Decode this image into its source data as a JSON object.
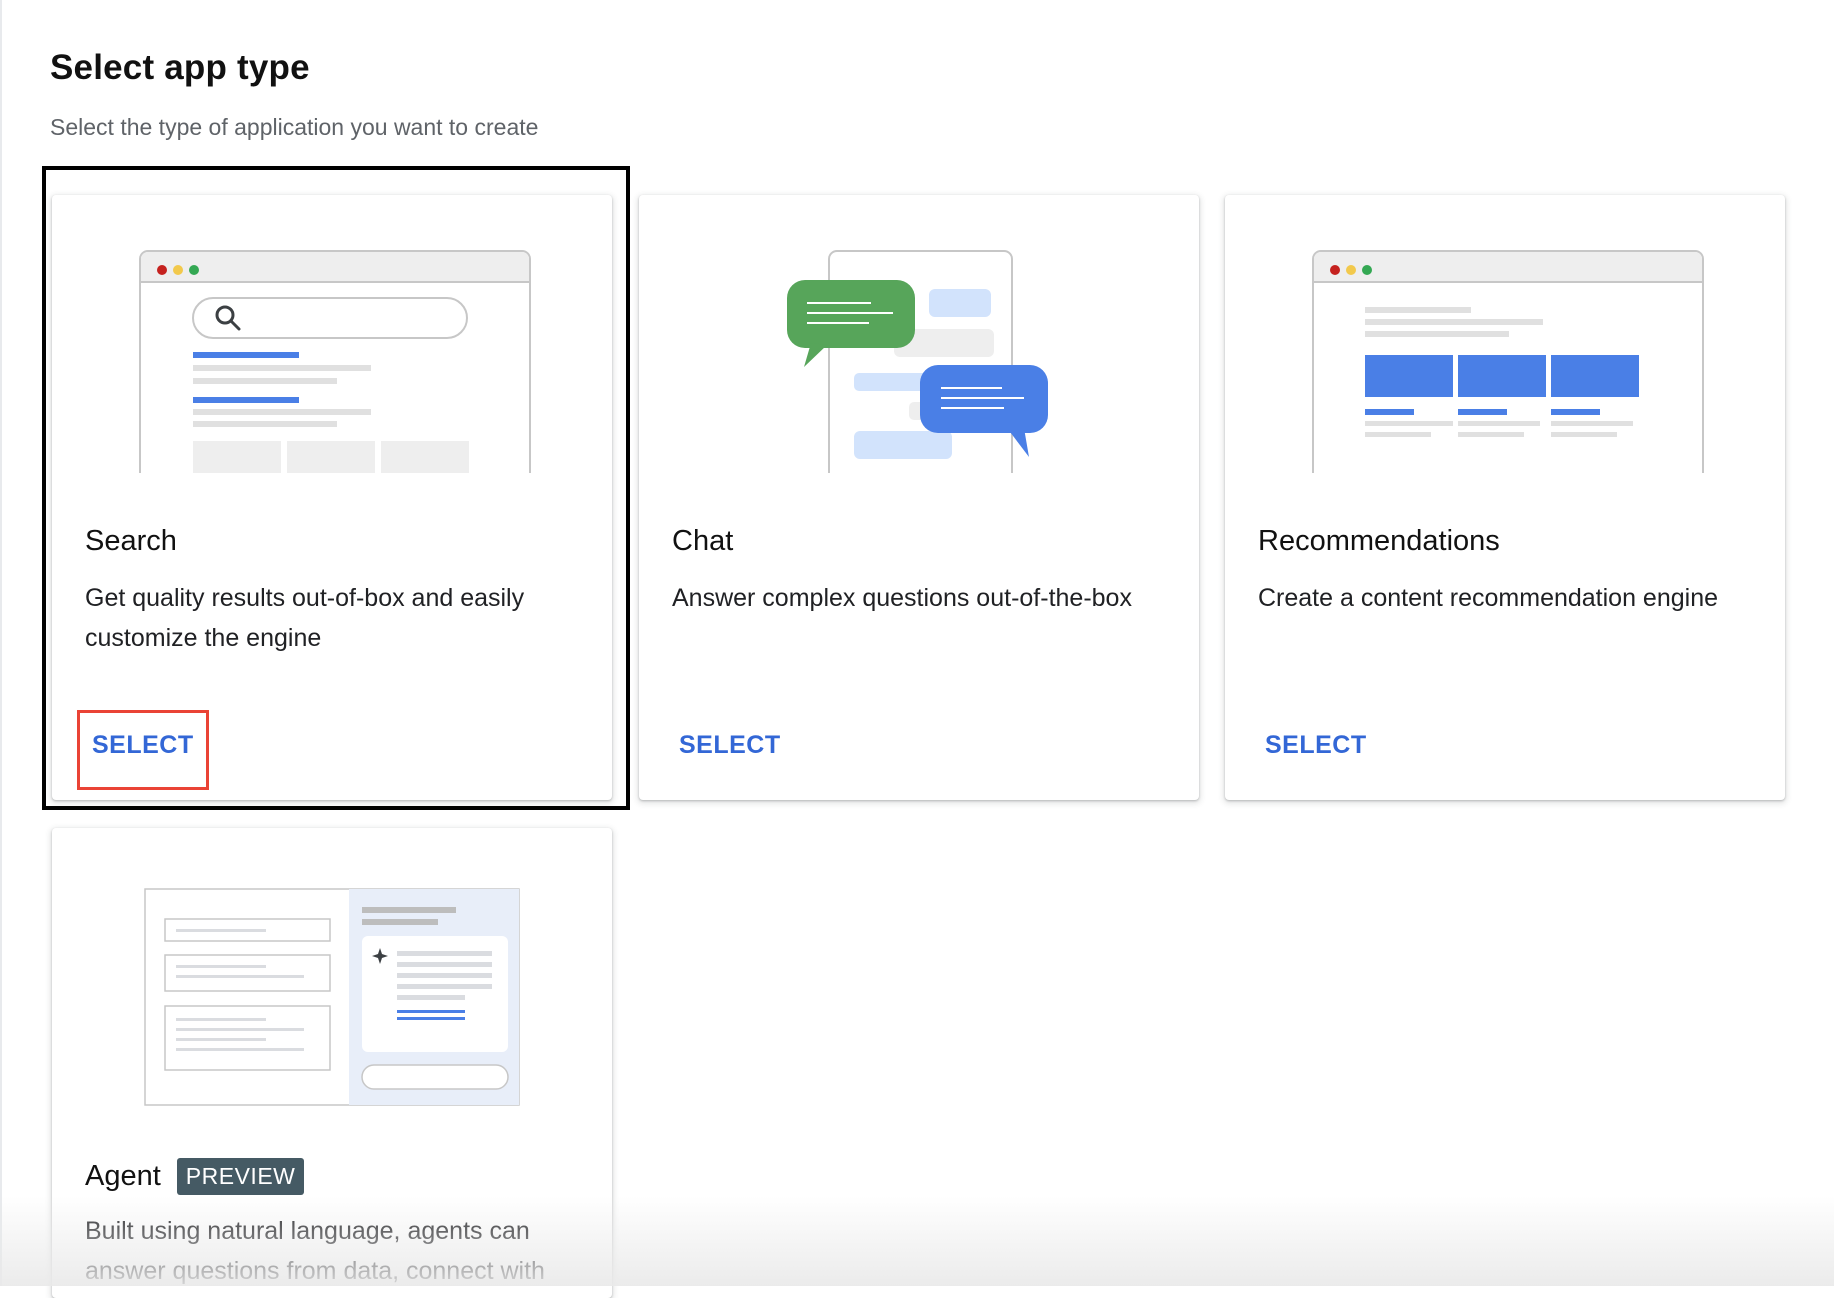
{
  "header": {
    "title": "Select app type",
    "subtitle": "Select the type of application you want to create"
  },
  "cards": [
    {
      "title": "Search",
      "description": "Get quality results out-of-box and easily customize the engine",
      "action": "SELECT",
      "selected": true
    },
    {
      "title": "Chat",
      "description": "Answer complex questions out-of-the-box",
      "action": "SELECT"
    },
    {
      "title": "Recommendations",
      "description": "Create a content recommendation engine",
      "action": "SELECT"
    },
    {
      "title": "Agent",
      "badge": "PREVIEW",
      "description": "Built using natural language, agents can answer questions from data, connect with"
    }
  ],
  "colors": {
    "accent_blue": "#4a7fe6",
    "link_blue": "#3367d6",
    "chat_green": "#57a55a",
    "badge_bg": "#455a64",
    "highlight_red": "#ea4335",
    "window_red": "#c5221f",
    "window_yellow": "#f2c94c",
    "window_green": "#34a853"
  },
  "icons": [
    "search-icon",
    "sparkle-icon",
    "chat-bubble-icon"
  ]
}
